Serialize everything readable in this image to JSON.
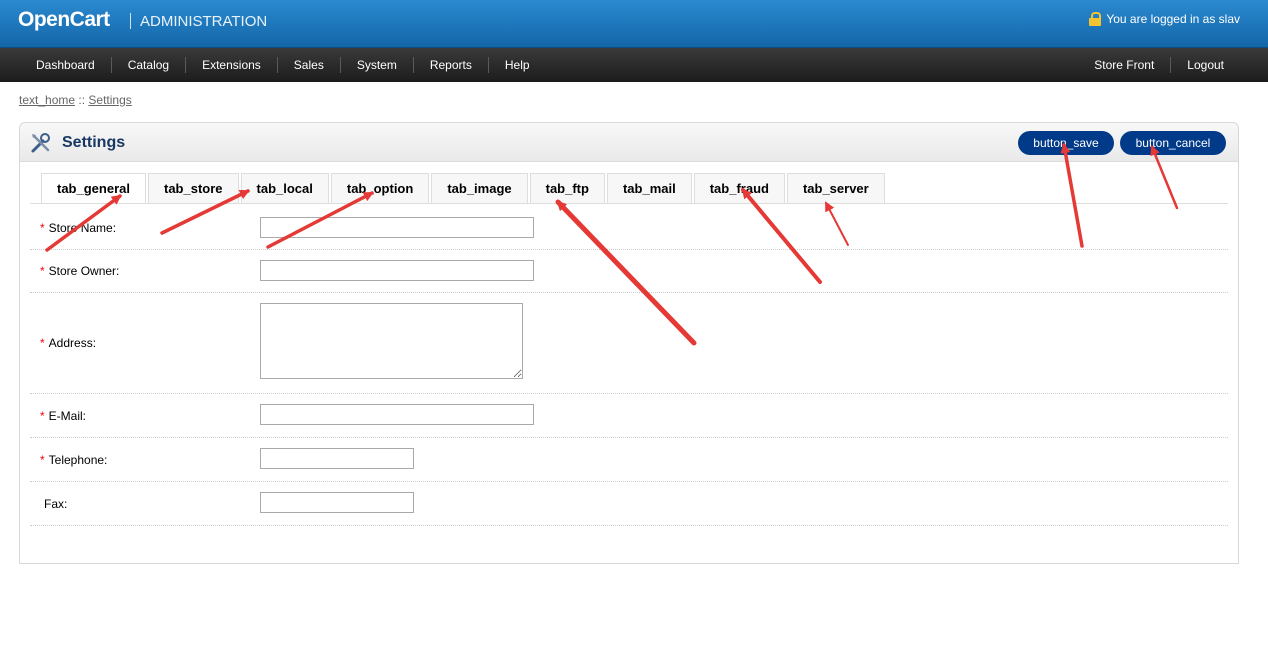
{
  "header": {
    "logo": "OpenCart",
    "subtitle": "ADMINISTRATION",
    "logged_in": "You are logged in as slav"
  },
  "menu": {
    "left": [
      "Dashboard",
      "Catalog",
      "Extensions",
      "Sales",
      "System",
      "Reports",
      "Help"
    ],
    "right": [
      "Store Front",
      "Logout"
    ]
  },
  "breadcrumb": {
    "home": "text_home",
    "separator": "::",
    "current": "Settings"
  },
  "box": {
    "title": "Settings",
    "save": "button_save",
    "cancel": "button_cancel"
  },
  "tabs": [
    "tab_general",
    "tab_store",
    "tab_local",
    "tab_option",
    "tab_image",
    "tab_ftp",
    "tab_mail",
    "tab_fraud",
    "tab_server"
  ],
  "active_tab": "tab_general",
  "form": {
    "fields": [
      {
        "label": "Store Name:",
        "required": "*",
        "value": ""
      },
      {
        "label": "Store Owner:",
        "required": "*",
        "value": ""
      },
      {
        "label": "Address:",
        "required": "*",
        "value": ""
      },
      {
        "label": "E-Mail:",
        "required": "*",
        "value": ""
      },
      {
        "label": "Telephone:",
        "required": "*",
        "value": ""
      },
      {
        "label": "Fax:",
        "required": "",
        "value": ""
      }
    ]
  },
  "colors": {
    "header": "#1a73b8",
    "menu": "#2a2a2a",
    "button": "#003a88",
    "title": "#183863",
    "annotation_arrow": "#e53935"
  },
  "icons": {
    "lock": "lock-icon",
    "settings": "tools-icon"
  }
}
